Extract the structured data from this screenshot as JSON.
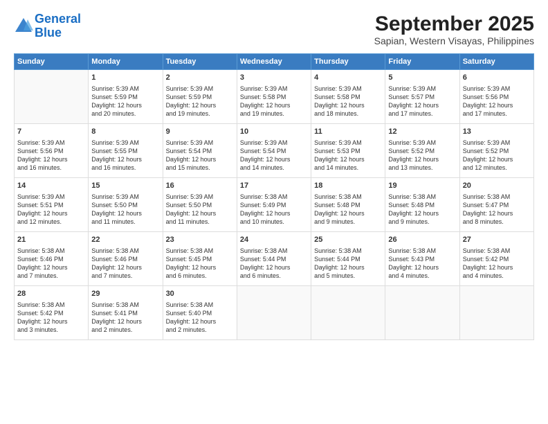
{
  "logo": {
    "line1": "General",
    "line2": "Blue"
  },
  "title": "September 2025",
  "subtitle": "Sapian, Western Visayas, Philippines",
  "weekdays": [
    "Sunday",
    "Monday",
    "Tuesday",
    "Wednesday",
    "Thursday",
    "Friday",
    "Saturday"
  ],
  "weeks": [
    [
      {
        "day": "",
        "content": ""
      },
      {
        "day": "1",
        "content": "Sunrise: 5:39 AM\nSunset: 5:59 PM\nDaylight: 12 hours\nand 20 minutes."
      },
      {
        "day": "2",
        "content": "Sunrise: 5:39 AM\nSunset: 5:59 PM\nDaylight: 12 hours\nand 19 minutes."
      },
      {
        "day": "3",
        "content": "Sunrise: 5:39 AM\nSunset: 5:58 PM\nDaylight: 12 hours\nand 19 minutes."
      },
      {
        "day": "4",
        "content": "Sunrise: 5:39 AM\nSunset: 5:58 PM\nDaylight: 12 hours\nand 18 minutes."
      },
      {
        "day": "5",
        "content": "Sunrise: 5:39 AM\nSunset: 5:57 PM\nDaylight: 12 hours\nand 17 minutes."
      },
      {
        "day": "6",
        "content": "Sunrise: 5:39 AM\nSunset: 5:56 PM\nDaylight: 12 hours\nand 17 minutes."
      }
    ],
    [
      {
        "day": "7",
        "content": "Sunrise: 5:39 AM\nSunset: 5:56 PM\nDaylight: 12 hours\nand 16 minutes."
      },
      {
        "day": "8",
        "content": "Sunrise: 5:39 AM\nSunset: 5:55 PM\nDaylight: 12 hours\nand 16 minutes."
      },
      {
        "day": "9",
        "content": "Sunrise: 5:39 AM\nSunset: 5:54 PM\nDaylight: 12 hours\nand 15 minutes."
      },
      {
        "day": "10",
        "content": "Sunrise: 5:39 AM\nSunset: 5:54 PM\nDaylight: 12 hours\nand 14 minutes."
      },
      {
        "day": "11",
        "content": "Sunrise: 5:39 AM\nSunset: 5:53 PM\nDaylight: 12 hours\nand 14 minutes."
      },
      {
        "day": "12",
        "content": "Sunrise: 5:39 AM\nSunset: 5:52 PM\nDaylight: 12 hours\nand 13 minutes."
      },
      {
        "day": "13",
        "content": "Sunrise: 5:39 AM\nSunset: 5:52 PM\nDaylight: 12 hours\nand 12 minutes."
      }
    ],
    [
      {
        "day": "14",
        "content": "Sunrise: 5:39 AM\nSunset: 5:51 PM\nDaylight: 12 hours\nand 12 minutes."
      },
      {
        "day": "15",
        "content": "Sunrise: 5:39 AM\nSunset: 5:50 PM\nDaylight: 12 hours\nand 11 minutes."
      },
      {
        "day": "16",
        "content": "Sunrise: 5:39 AM\nSunset: 5:50 PM\nDaylight: 12 hours\nand 11 minutes."
      },
      {
        "day": "17",
        "content": "Sunrise: 5:38 AM\nSunset: 5:49 PM\nDaylight: 12 hours\nand 10 minutes."
      },
      {
        "day": "18",
        "content": "Sunrise: 5:38 AM\nSunset: 5:48 PM\nDaylight: 12 hours\nand 9 minutes."
      },
      {
        "day": "19",
        "content": "Sunrise: 5:38 AM\nSunset: 5:48 PM\nDaylight: 12 hours\nand 9 minutes."
      },
      {
        "day": "20",
        "content": "Sunrise: 5:38 AM\nSunset: 5:47 PM\nDaylight: 12 hours\nand 8 minutes."
      }
    ],
    [
      {
        "day": "21",
        "content": "Sunrise: 5:38 AM\nSunset: 5:46 PM\nDaylight: 12 hours\nand 7 minutes."
      },
      {
        "day": "22",
        "content": "Sunrise: 5:38 AM\nSunset: 5:46 PM\nDaylight: 12 hours\nand 7 minutes."
      },
      {
        "day": "23",
        "content": "Sunrise: 5:38 AM\nSunset: 5:45 PM\nDaylight: 12 hours\nand 6 minutes."
      },
      {
        "day": "24",
        "content": "Sunrise: 5:38 AM\nSunset: 5:44 PM\nDaylight: 12 hours\nand 6 minutes."
      },
      {
        "day": "25",
        "content": "Sunrise: 5:38 AM\nSunset: 5:44 PM\nDaylight: 12 hours\nand 5 minutes."
      },
      {
        "day": "26",
        "content": "Sunrise: 5:38 AM\nSunset: 5:43 PM\nDaylight: 12 hours\nand 4 minutes."
      },
      {
        "day": "27",
        "content": "Sunrise: 5:38 AM\nSunset: 5:42 PM\nDaylight: 12 hours\nand 4 minutes."
      }
    ],
    [
      {
        "day": "28",
        "content": "Sunrise: 5:38 AM\nSunset: 5:42 PM\nDaylight: 12 hours\nand 3 minutes."
      },
      {
        "day": "29",
        "content": "Sunrise: 5:38 AM\nSunset: 5:41 PM\nDaylight: 12 hours\nand 2 minutes."
      },
      {
        "day": "30",
        "content": "Sunrise: 5:38 AM\nSunset: 5:40 PM\nDaylight: 12 hours\nand 2 minutes."
      },
      {
        "day": "",
        "content": ""
      },
      {
        "day": "",
        "content": ""
      },
      {
        "day": "",
        "content": ""
      },
      {
        "day": "",
        "content": ""
      }
    ]
  ]
}
